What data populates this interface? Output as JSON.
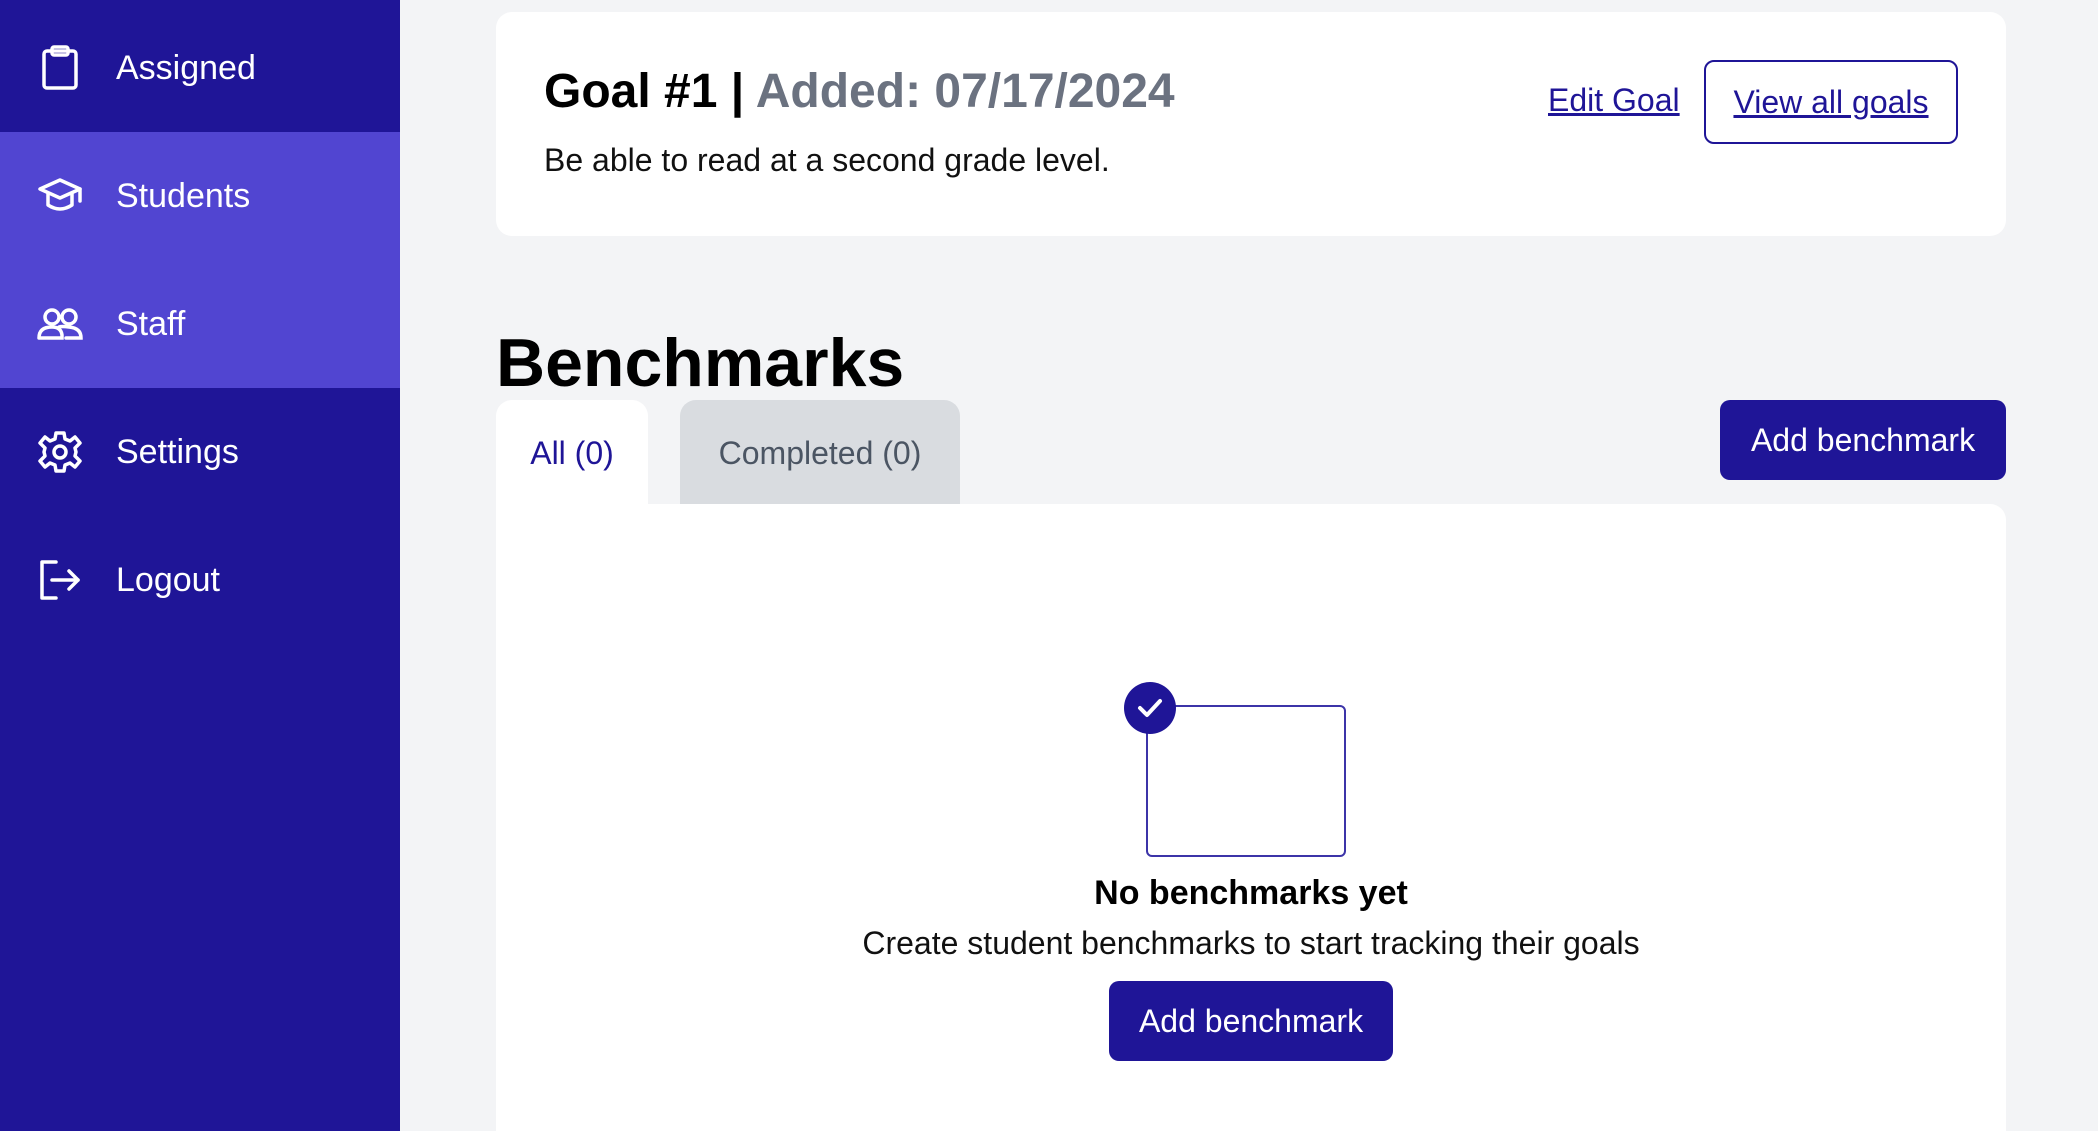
{
  "sidebar": {
    "items": [
      {
        "label": "Assigned",
        "icon": "clipboard-icon"
      },
      {
        "label": "Students",
        "icon": "graduation-cap-icon"
      },
      {
        "label": "Staff",
        "icon": "users-icon"
      },
      {
        "label": "Settings",
        "icon": "gear-icon"
      },
      {
        "label": "Logout",
        "icon": "logout-icon"
      }
    ]
  },
  "goal": {
    "title": "Goal #1 |",
    "added": "Added: 07/17/2024",
    "description": "Be able to read at a second grade level.",
    "edit_label": "Edit Goal",
    "view_all_label": "View all goals"
  },
  "benchmarks": {
    "heading": "Benchmarks",
    "tabs": [
      {
        "label": "All (0)"
      },
      {
        "label": "Completed (0)"
      }
    ],
    "add_button_label": "Add benchmark",
    "empty_state": {
      "title": "No benchmarks yet",
      "subtitle": "Create student benchmarks to start tracking their goals",
      "button_label": "Add benchmark"
    }
  },
  "colors": {
    "sidebar_bg": "#1f1597",
    "sidebar_active": "#5145d1",
    "primary": "#1f1597",
    "page_bg": "#f3f4f6",
    "muted_text": "#6b7280"
  }
}
